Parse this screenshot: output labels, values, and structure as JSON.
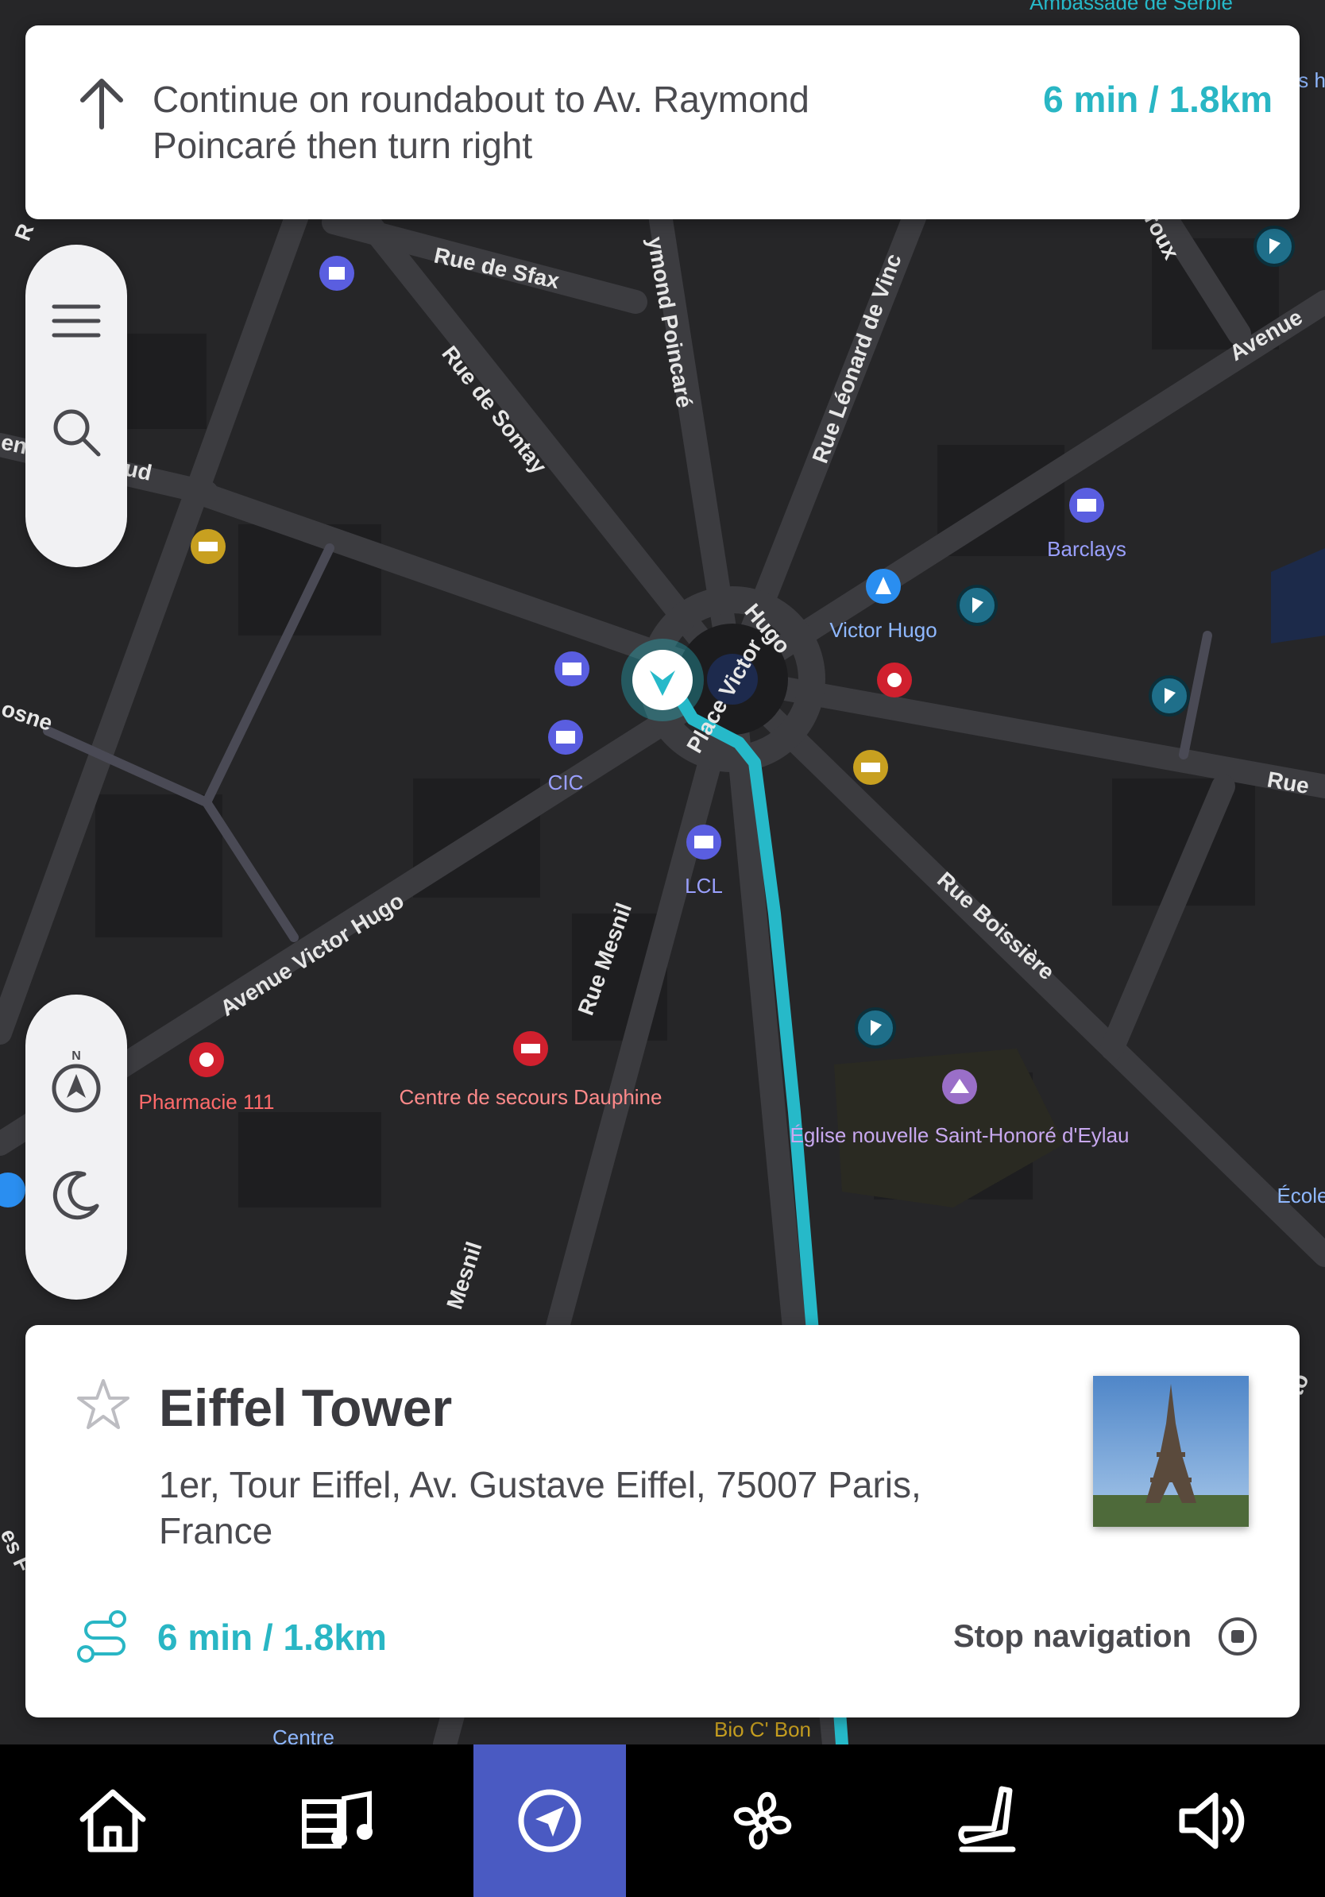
{
  "navigation": {
    "instruction": "Continue on roundabout to Av. Raymond Poincaré then turn right",
    "eta": "6 min  /  1.8km",
    "direction_icon": "arrow-up-icon"
  },
  "map": {
    "street_labels": [
      "Rue de Sfax",
      "Rue de Sontay",
      "ymond Poincaré",
      "Rue Léonard de Vinc",
      "Avenue",
      "enue Bugeaud",
      "osne",
      "Hugo",
      "Place Victor",
      "Rue",
      "Avenue Victor Hugo",
      "Rue Mesnil",
      "Rue Boissière",
      "Mesnil",
      "roux",
      "isto",
      "es F",
      "R"
    ],
    "poi_labels": [
      "Barclays",
      "Victor Hugo",
      "CIC",
      "LCL",
      "Pharmacie 111",
      "Centre de secours Dauphine",
      "Église nouvelle Saint-Honoré d'Eylau",
      "École",
      "Bio C' Bon",
      "Centre",
      "Ambassade de Serbie",
      "is hn"
    ],
    "route_color": "#26b9c9",
    "poi_colors": {
      "bank": "#5a5ee0",
      "pharmacy": "#d0202e",
      "shop": "#c8a020",
      "transit": "#1f6f8a",
      "church": "#9a6fc8"
    }
  },
  "controls": {
    "menu_icon": "menu-icon",
    "search_icon": "search-icon",
    "compass_icon": "compass-icon",
    "compass_label": "N",
    "night_icon": "moon-icon"
  },
  "destination": {
    "title": "Eiffel Tower",
    "address": "1er, Tour Eiffel, Av. Gustave Eiffel, 75007 Paris, France",
    "eta": "6 min  /  1.8km",
    "stop_label": "Stop navigation",
    "favorite_icon": "star-icon",
    "route_icon": "route-icon",
    "stop_icon": "stop-circle-icon"
  },
  "bottom_nav": {
    "tabs": [
      "home-icon",
      "media-icon",
      "navigation-icon",
      "climate-fan-icon",
      "seat-icon",
      "volume-icon"
    ],
    "active": "navigation-icon",
    "active_color": "#4a5ac2"
  }
}
